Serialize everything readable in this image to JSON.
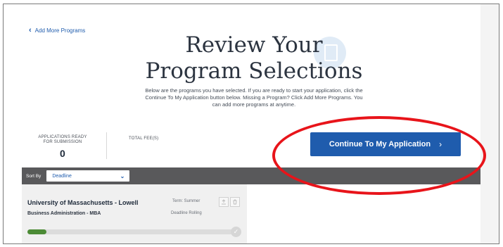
{
  "nav": {
    "back_label": "Add More Programs"
  },
  "header": {
    "title_line1": "Review Your",
    "title_line2": "Program Selections",
    "subtitle": "Below are the programs you have selected. If you are ready to start your application, click the Continue To My Application button below. Missing a Program? Click Add More Programs. You can add more programs at anytime."
  },
  "stats": {
    "ready_label_line1": "APPLICATIONS READY",
    "ready_label_line2": "FOR SUBMISSION",
    "ready_count": "0",
    "fees_label": "TOTAL FEE(S)"
  },
  "actions": {
    "continue_label": "Continue To My Application",
    "continue_chevron": "›"
  },
  "sort": {
    "label": "Sort By",
    "selected": "Deadline"
  },
  "programs": [
    {
      "university": "University of Massachusetts - Lowell",
      "program": "Business Administration - MBA",
      "term": "Term: Summer",
      "deadline": "Deadline Rolling",
      "progress": 0.09
    }
  ],
  "icons": {
    "back": "chevron-left-icon",
    "continue": "chevron-right-icon",
    "sort": "chevron-down-icon",
    "upload": "upload-icon",
    "trash": "trash-icon",
    "check": "check-circle-icon"
  },
  "colors": {
    "brand": "#1f5cad",
    "sort_bar": "#59595b",
    "progress": "#4c8b36",
    "annotation": "#e8141a"
  }
}
